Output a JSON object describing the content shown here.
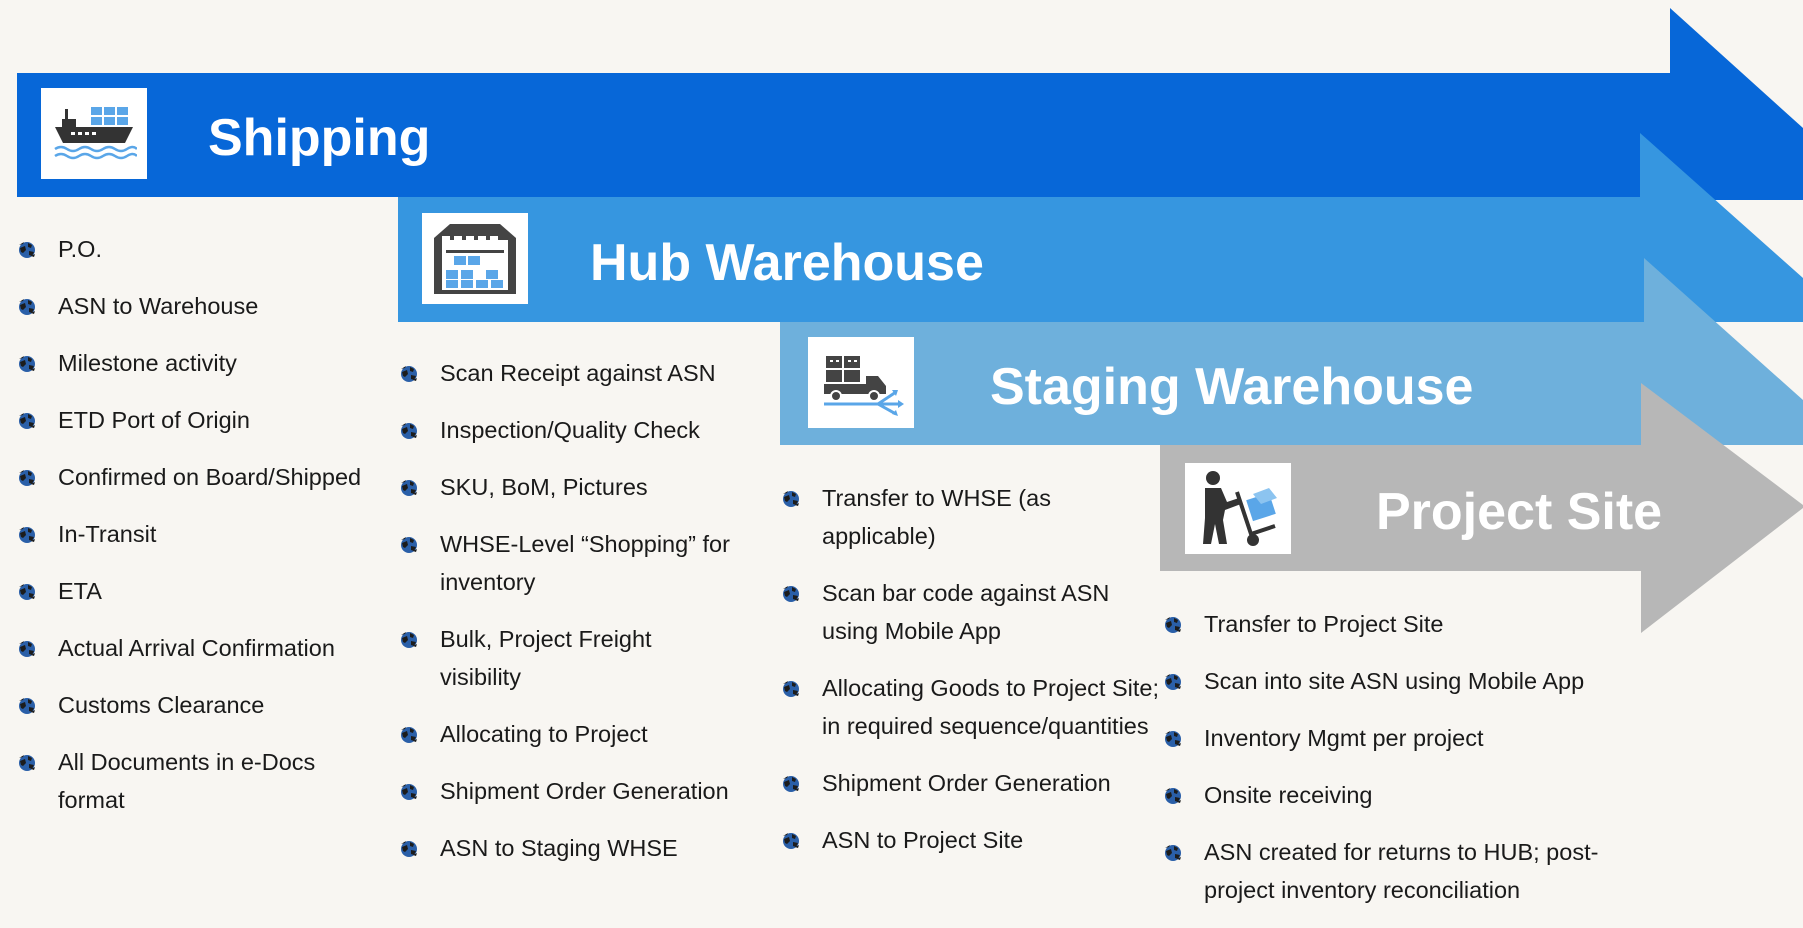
{
  "colors": {
    "shipping": "#0767d8",
    "hub": "#3696e0",
    "staging": "#6eb0dc",
    "project": "#b7b7b7",
    "background": "#f8f6f2"
  },
  "stages": [
    {
      "title": "Shipping",
      "icon": "ship-icon",
      "items": [
        "P.O.",
        "ASN to Warehouse",
        "Milestone activity",
        "ETD Port of Origin",
        "Confirmed on Board/Shipped",
        "In-Transit",
        "ETA",
        "Actual Arrival Confirmation",
        "Customs Clearance",
        "All Documents in e-Docs format"
      ]
    },
    {
      "title": "Hub Warehouse",
      "icon": "warehouse-icon",
      "items": [
        "Scan Receipt against ASN",
        "Inspection/Quality Check",
        "SKU, BoM, Pictures",
        "WHSE-Level “Shopping” for inventory",
        "Bulk, Project Freight visibility",
        "Allocating to Project",
        "Shipment Order Generation",
        "ASN to Staging WHSE"
      ]
    },
    {
      "title": "Staging Warehouse",
      "icon": "delivery-truck-icon",
      "items": [
        "Transfer to WHSE (as applicable)",
        "Scan bar code against ASN using Mobile App",
        "Allocating Goods to Project Site; in required sequence/quantities",
        "Shipment Order Generation",
        "ASN to Project Site"
      ]
    },
    {
      "title": "Project Site",
      "icon": "hand-truck-icon",
      "items": [
        "Transfer to Project Site",
        "Scan into site ASN using Mobile App",
        "Inventory Mgmt per project",
        "Onsite receiving",
        "ASN created for returns to HUB; post-project inventory reconciliation"
      ]
    }
  ]
}
